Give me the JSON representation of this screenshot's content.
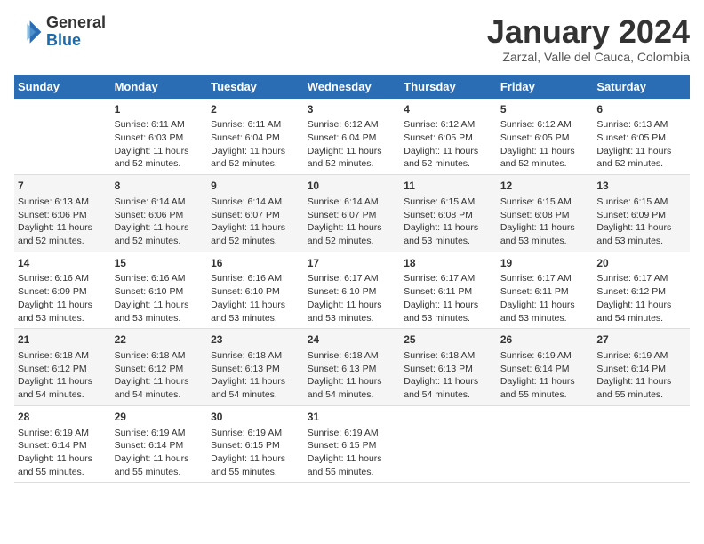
{
  "header": {
    "logo_general": "General",
    "logo_blue": "Blue",
    "month_title": "January 2024",
    "location": "Zarzal, Valle del Cauca, Colombia"
  },
  "weekdays": [
    "Sunday",
    "Monday",
    "Tuesday",
    "Wednesday",
    "Thursday",
    "Friday",
    "Saturday"
  ],
  "weeks": [
    [
      {
        "day": "",
        "info": ""
      },
      {
        "day": "1",
        "info": "Sunrise: 6:11 AM\nSunset: 6:03 PM\nDaylight: 11 hours\nand 52 minutes."
      },
      {
        "day": "2",
        "info": "Sunrise: 6:11 AM\nSunset: 6:04 PM\nDaylight: 11 hours\nand 52 minutes."
      },
      {
        "day": "3",
        "info": "Sunrise: 6:12 AM\nSunset: 6:04 PM\nDaylight: 11 hours\nand 52 minutes."
      },
      {
        "day": "4",
        "info": "Sunrise: 6:12 AM\nSunset: 6:05 PM\nDaylight: 11 hours\nand 52 minutes."
      },
      {
        "day": "5",
        "info": "Sunrise: 6:12 AM\nSunset: 6:05 PM\nDaylight: 11 hours\nand 52 minutes."
      },
      {
        "day": "6",
        "info": "Sunrise: 6:13 AM\nSunset: 6:05 PM\nDaylight: 11 hours\nand 52 minutes."
      }
    ],
    [
      {
        "day": "7",
        "info": "Sunrise: 6:13 AM\nSunset: 6:06 PM\nDaylight: 11 hours\nand 52 minutes."
      },
      {
        "day": "8",
        "info": "Sunrise: 6:14 AM\nSunset: 6:06 PM\nDaylight: 11 hours\nand 52 minutes."
      },
      {
        "day": "9",
        "info": "Sunrise: 6:14 AM\nSunset: 6:07 PM\nDaylight: 11 hours\nand 52 minutes."
      },
      {
        "day": "10",
        "info": "Sunrise: 6:14 AM\nSunset: 6:07 PM\nDaylight: 11 hours\nand 52 minutes."
      },
      {
        "day": "11",
        "info": "Sunrise: 6:15 AM\nSunset: 6:08 PM\nDaylight: 11 hours\nand 53 minutes."
      },
      {
        "day": "12",
        "info": "Sunrise: 6:15 AM\nSunset: 6:08 PM\nDaylight: 11 hours\nand 53 minutes."
      },
      {
        "day": "13",
        "info": "Sunrise: 6:15 AM\nSunset: 6:09 PM\nDaylight: 11 hours\nand 53 minutes."
      }
    ],
    [
      {
        "day": "14",
        "info": "Sunrise: 6:16 AM\nSunset: 6:09 PM\nDaylight: 11 hours\nand 53 minutes."
      },
      {
        "day": "15",
        "info": "Sunrise: 6:16 AM\nSunset: 6:10 PM\nDaylight: 11 hours\nand 53 minutes."
      },
      {
        "day": "16",
        "info": "Sunrise: 6:16 AM\nSunset: 6:10 PM\nDaylight: 11 hours\nand 53 minutes."
      },
      {
        "day": "17",
        "info": "Sunrise: 6:17 AM\nSunset: 6:10 PM\nDaylight: 11 hours\nand 53 minutes."
      },
      {
        "day": "18",
        "info": "Sunrise: 6:17 AM\nSunset: 6:11 PM\nDaylight: 11 hours\nand 53 minutes."
      },
      {
        "day": "19",
        "info": "Sunrise: 6:17 AM\nSunset: 6:11 PM\nDaylight: 11 hours\nand 53 minutes."
      },
      {
        "day": "20",
        "info": "Sunrise: 6:17 AM\nSunset: 6:12 PM\nDaylight: 11 hours\nand 54 minutes."
      }
    ],
    [
      {
        "day": "21",
        "info": "Sunrise: 6:18 AM\nSunset: 6:12 PM\nDaylight: 11 hours\nand 54 minutes."
      },
      {
        "day": "22",
        "info": "Sunrise: 6:18 AM\nSunset: 6:12 PM\nDaylight: 11 hours\nand 54 minutes."
      },
      {
        "day": "23",
        "info": "Sunrise: 6:18 AM\nSunset: 6:13 PM\nDaylight: 11 hours\nand 54 minutes."
      },
      {
        "day": "24",
        "info": "Sunrise: 6:18 AM\nSunset: 6:13 PM\nDaylight: 11 hours\nand 54 minutes."
      },
      {
        "day": "25",
        "info": "Sunrise: 6:18 AM\nSunset: 6:13 PM\nDaylight: 11 hours\nand 54 minutes."
      },
      {
        "day": "26",
        "info": "Sunrise: 6:19 AM\nSunset: 6:14 PM\nDaylight: 11 hours\nand 55 minutes."
      },
      {
        "day": "27",
        "info": "Sunrise: 6:19 AM\nSunset: 6:14 PM\nDaylight: 11 hours\nand 55 minutes."
      }
    ],
    [
      {
        "day": "28",
        "info": "Sunrise: 6:19 AM\nSunset: 6:14 PM\nDaylight: 11 hours\nand 55 minutes."
      },
      {
        "day": "29",
        "info": "Sunrise: 6:19 AM\nSunset: 6:14 PM\nDaylight: 11 hours\nand 55 minutes."
      },
      {
        "day": "30",
        "info": "Sunrise: 6:19 AM\nSunset: 6:15 PM\nDaylight: 11 hours\nand 55 minutes."
      },
      {
        "day": "31",
        "info": "Sunrise: 6:19 AM\nSunset: 6:15 PM\nDaylight: 11 hours\nand 55 minutes."
      },
      {
        "day": "",
        "info": ""
      },
      {
        "day": "",
        "info": ""
      },
      {
        "day": "",
        "info": ""
      }
    ]
  ]
}
